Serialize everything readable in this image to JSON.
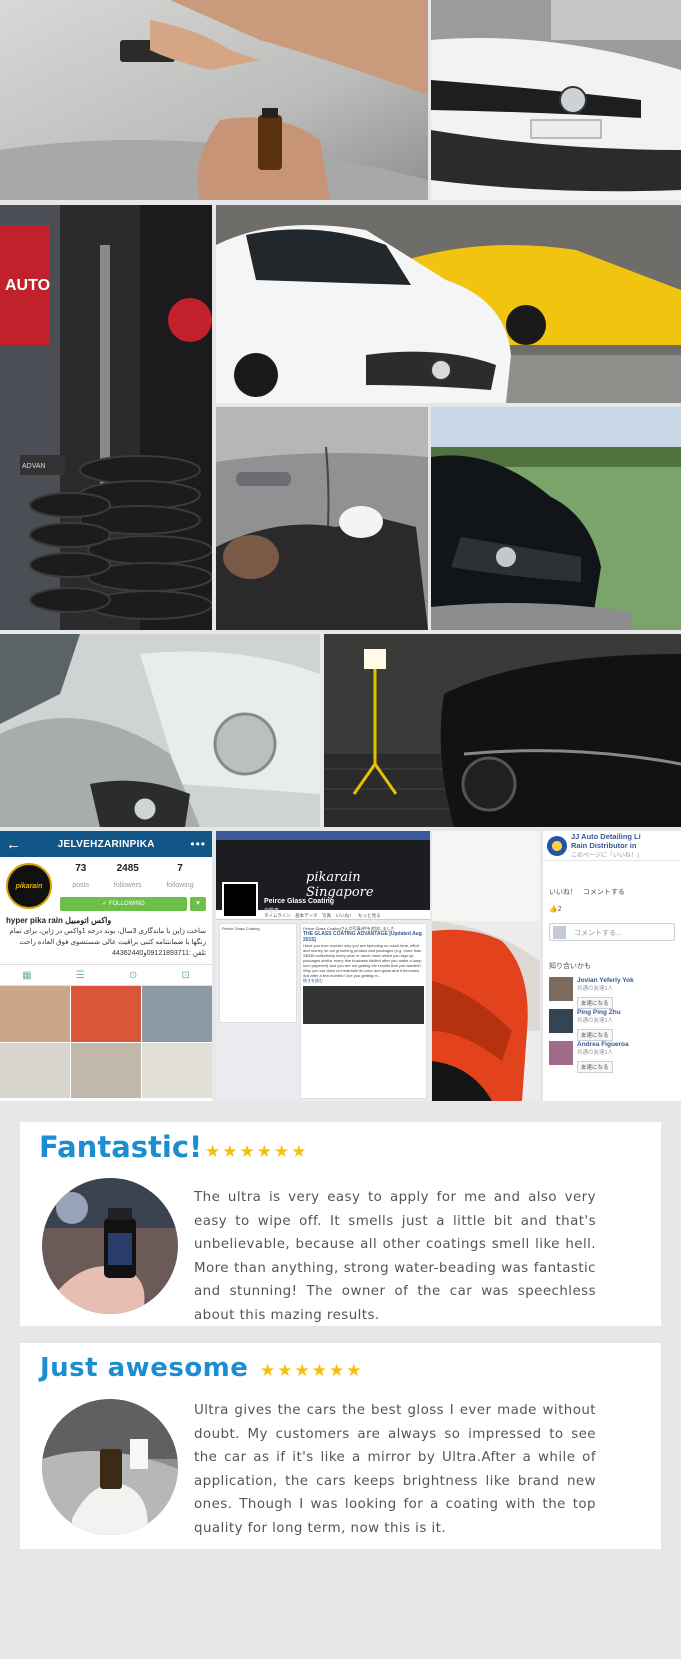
{
  "instagram": {
    "username": "JELVEHZARINPIKA",
    "back_glyph": "←",
    "menu_glyph": "•••",
    "avatar_text": "pikarain",
    "posts": "73",
    "posts_label": "posts",
    "followers": "2485",
    "followers_label": "followers",
    "following": "7",
    "following_label": "following",
    "follow_button": "✓ FOLLOWING",
    "follow_dropdown": "▾",
    "bio_title": "hyper pika rain واکس اتومبیل",
    "bio_text": "ساخت ژاپن با ماندگاری 3سال، بوند درجه 1واکس در ژاپن، برای تمام رنگها با ضمانتنامه کتبی براقیت عالی شستشوی فوق العاده راحت",
    "bio_phone": "تلفن :09121893711و44362440"
  },
  "facebook_page": {
    "tab_title": "Peirce Glass Coating",
    "brand_text": "pikarain Singapore",
    "logo_text": "pikarain",
    "page_name": "Peirce Glass Coating",
    "category": "自動車",
    "nav_text": "タイムライン　基本データ　写真　いいね！　もっと見る",
    "post_author": "Peirce Glass Coatingさんが写真8件を追加しました",
    "post_title": "THE GLASS COATING ADVANTAGE [Updated Aug 2015]",
    "post_body": "Have you ever wonder why you are spending so much time, effort and money on car grooming product and packages (e.g. more than S$438 collectively every year or much more which you sign up packages and/or every fine business fiddled after you make a lump sum payment) and you are not getting the results that you wanted? Why you car does not maintain its color and gloss and it becomes dull after a few months? Are you getting m..",
    "see_more": "続きを読む"
  },
  "facebook_group": {
    "name": "JJ Auto Detailing Li",
    "sub": "Rain Distributor in",
    "sub2": "このページに「いいね！」",
    "like_action": "いいね！",
    "comment_action": "コメントする",
    "like_count": "2",
    "comment_placeholder": "コメントする...",
    "friends_section": "知り合いかも",
    "people": [
      {
        "name": "Jovian Yeferly Yok",
        "mutual": "共通の友達1人",
        "button": "友達になる"
      },
      {
        "name": "Ping Ping Zhu",
        "mutual": "共通の友達1人",
        "button": "友達になる"
      },
      {
        "name": "Andrea Figueroa",
        "mutual": "共通の友達1人",
        "button": "友達になる"
      }
    ]
  },
  "reviews": [
    {
      "title": "Fantastic!",
      "stars": "★★★★★★",
      "text": "The ultra is very easy to apply for me and also very easy to wipe off. It smells just a little bit and that's unbelievable, because all other coatings smell like hell. More than anything, strong water-beading was fantastic and stunning! The owner of the car was speechless about this mazing results."
    },
    {
      "title": "Just awesome",
      "stars": "★★★★★★",
      "text": "Ultra gives the cars the best gloss I ever made without doubt. My customers are always so impressed to see the car as if it's like a mirror by Ultra.After a while of application, the cars keeps brightness like brand new ones. Though I was looking for a coating with the top quality for long term, now this is it."
    }
  ],
  "photo_signs": {
    "auto_sign": "AUTO",
    "shop_sign": "ADVAN"
  }
}
